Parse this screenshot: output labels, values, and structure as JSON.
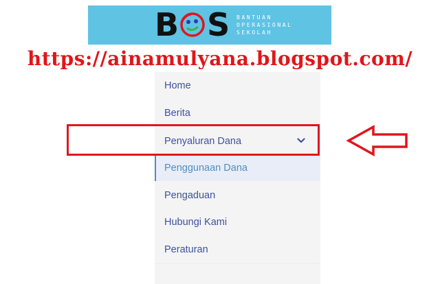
{
  "banner": {
    "logo_letters": [
      "B",
      "S"
    ],
    "subtitle_lines": [
      "BANTUAN",
      "OPERASIONAL",
      "SEKOLAH"
    ],
    "face_color": "#e0161b"
  },
  "caption": {
    "url": "https://ainamulyana.blogspot.com/",
    "color": "#e0161b"
  },
  "menu": {
    "items": [
      {
        "label": "Home"
      },
      {
        "label": "Berita"
      },
      {
        "label": "Penyaluran Dana",
        "icon": "chevron-down-icon"
      },
      {
        "label": "Penggunaan Dana"
      },
      {
        "label": "Pengaduan"
      },
      {
        "label": "Hubungi Kami"
      },
      {
        "label": "Peraturan"
      }
    ],
    "text_color": "#3f51a3",
    "active_color": "#4f8ec2"
  }
}
